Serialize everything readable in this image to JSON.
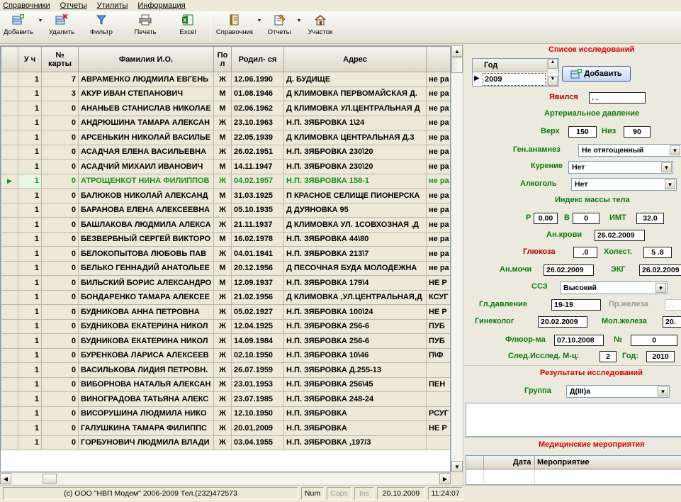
{
  "menu": [
    "Справочники",
    "Отчеты",
    "Утилиты",
    "Информация"
  ],
  "toolbar": [
    {
      "label": "Добавить",
      "icon": "add-record-icon",
      "dropdown": true
    },
    {
      "label": "Удалить",
      "icon": "delete-record-icon"
    },
    {
      "label": "Фильтр",
      "icon": "filter-icon"
    },
    {
      "label": "Печать",
      "icon": "printer-icon"
    },
    {
      "label": "Excel",
      "icon": "excel-icon"
    },
    {
      "label": "Справочник",
      "icon": "reference-book-icon",
      "dropdown": true
    },
    {
      "label": "Отчеты",
      "icon": "reports-icon",
      "dropdown": true
    },
    {
      "label": "Участок",
      "icon": "house-icon"
    }
  ],
  "table": {
    "columns": [
      "У ч",
      "№ карты",
      "Фамилия И.О.",
      "По л",
      "Родил- ся",
      "Адрес",
      ""
    ],
    "selected_row": 7,
    "rows": [
      [
        "1",
        "7",
        "АВРАМЕНКО ЛЮДМИЛА ЕВГЕНЬ",
        "Ж",
        "12.06.1990",
        "Д. БУДИЩЕ",
        "не ра"
      ],
      [
        "1",
        "3",
        "АКУР ИВАН СТЕПАНОВИЧ",
        "М",
        "01.08.1946",
        "Д КЛИМОВКА ПЕРВОМАЙСКАЯ Д.",
        "не ра"
      ],
      [
        "1",
        "0",
        "АНАНЬЕВ СТАНИСЛАВ НИКОЛАЕ",
        "М",
        "02.06.1962",
        "Д КЛИМОВКА УЛ.ЦЕНТРАЛЬНАЯ Д",
        "не ра"
      ],
      [
        "1",
        "0",
        "АНДРЮШИНА ТАМАРА АЛЕКСАН",
        "Ж",
        "23.10.1963",
        "Н.П. ЗЯБРОВКА 1\\24",
        "не ра"
      ],
      [
        "1",
        "0",
        "АРСЕНЬКИН НИКОЛАЙ ВАСИЛЬЕ",
        "М",
        "22.05.1939",
        "Д КЛИМОВКА ЦЕНТРАЛЬНАЯ Д.3",
        "не ра"
      ],
      [
        "1",
        "0",
        "АСАДЧАЯ ЕЛЕНА ВАСИЛЬЕВНА",
        "Ж",
        "26.02.1951",
        "Н.П. ЗЯБРОВКА 230\\20",
        "не ра"
      ],
      [
        "1",
        "0",
        "АСАДЧИЙ МИХАИЛ ИВАНОВИЧ",
        "М",
        "14.11.1947",
        "Н.П. ЗЯБРОВКА 230\\20",
        "не ра"
      ],
      [
        "1",
        "0",
        "АТРОЩЕНКОТ НИНА ФИЛИППОВ",
        "Ж",
        "04.02.1957",
        "Н.П. ЗЯБРОВКА 158-1",
        "не ра"
      ],
      [
        "1",
        "0",
        "БАЛЮКОВ НИКОЛАЙ АЛЕКСАНД",
        "М",
        "31.03.1925",
        "П КРАСНОЕ СЕЛИЩЕ ПИОНЕРСКА",
        "не ра"
      ],
      [
        "1",
        "0",
        "БАРАНОВА ЕЛЕНА АЛЕКСЕЕВНА",
        "Ж",
        "05.10.1935",
        "Д ДУЯНОВКА 95",
        "не ра"
      ],
      [
        "1",
        "0",
        "БАШЛАКОВА ЛЮДМИЛА АЛЕКСА",
        "Ж",
        "21.11.1937",
        "Д КЛИМОВКА УЛ. 1СОВХОЗНАЯ ,Д",
        "не ра"
      ],
      [
        "1",
        "0",
        "БЕЗВЕРБНЫЙ СЕРГЕЙ ВИКТОРО",
        "М",
        "16.02.1978",
        "Н.П. ЗЯБРОВКА 44\\80",
        "не ра"
      ],
      [
        "1",
        "0",
        "БЕЛОКОПЫТОВА ЛЮБОВЬ ПАВ",
        "Ж",
        "04.01.1941",
        "Н.П. ЗЯБРОВКА 213\\7",
        "не ра"
      ],
      [
        "1",
        "0",
        "БЕЛЬКО ГЕННАДИЙ АНАТОЛЬЕЕ",
        "М",
        "20.12.1956",
        "Д ПЕСОЧНАЯ БУДА МОЛОДЕЖНА",
        "не ра"
      ],
      [
        "1",
        "0",
        "БИЛЬСКИЙ БОРИС АЛЕКСАНДРО",
        "М",
        "12.09.1937",
        "Н.П. ЗЯБРОВКА 179\\4",
        "НЕ Р"
      ],
      [
        "1",
        "0",
        "БОНДАРЕНКО ТАМАРА АЛЕКСЕЕ",
        "Ж",
        "21.02.1956",
        "Д КЛИМОВКА ,УЛ.ЦЕНТРАЛЬНАЯ,Д",
        "КСУГ"
      ],
      [
        "1",
        "0",
        "БУДНИКОВА АННА ПЕТРОВНА",
        "Ж",
        "05.02.1927",
        "Н.П. ЗЯБРОВКА 100\\24",
        "НЕ Р"
      ],
      [
        "1",
        "0",
        "БУДНИКОВА ЕКАТЕРИНА НИКОЛ",
        "Ж",
        "12.04.1925",
        "Н.П. ЗЯБРОВКА 256-6",
        "ПУБ"
      ],
      [
        "1",
        "0",
        "БУДНИКОВА ЕКАТЕРИНА НИКОЛ",
        "Ж",
        "14.09.1984",
        "Н.П. ЗЯБРОВКА 256-6",
        "ПУБ"
      ],
      [
        "1",
        "0",
        "БУРЕНКОВА ЛАРИСА АЛЕКСЕЕВ",
        "Ж",
        "02.10.1950",
        "Н.П. ЗЯБРОВКА 10\\46",
        "П\\Ф"
      ],
      [
        "1",
        "0",
        "ВАСИЛЬКОВА ЛИДИЯ ПЕТРОВН.",
        "Ж",
        "26.07.1959",
        "Н.П. ЗЯБРОВКА Д.255-13",
        ""
      ],
      [
        "1",
        "0",
        "ВИБОРНОВА НАТАЛЬЯ АЛЕКСАН",
        "Ж",
        "23.01.1953",
        "Н.П. ЗЯБРОВКА 256\\45",
        "ПЕН"
      ],
      [
        "1",
        "0",
        "ВИНОГРАДОВА ТАТЬЯНА АЛЕКС",
        "Ж",
        "23.07.1985",
        "Н.П. ЗЯБРОВКА 248-24",
        ""
      ],
      [
        "1",
        "0",
        "ВИСОРУШИНА ЛЮДМИЛА НИКО",
        "Ж",
        "12.10.1950",
        "Н.П. ЗЯБРОВКА",
        "РСУГ"
      ],
      [
        "1",
        "0",
        "ГАЛУШКИНА ТАМАРА ФИЛИППС",
        "Ж",
        "20.01.2009",
        "Н.П. ЗЯБРОВКА",
        "НЕ Р"
      ],
      [
        "1",
        "0",
        "ГОРБУНОВИЧ ЛЮДМИЛА ВЛАДИ",
        "Ж",
        "03.04.1955",
        "Н.П. ЗЯБРОВКА ,197/3",
        ""
      ]
    ]
  },
  "status": {
    "copyright": "(с) ООО \"НВП Модем\" 2006-2009  Тел.(232)472573",
    "num": "Num",
    "caps": "Caps",
    "ins": "Ins",
    "date": "20.10.2009",
    "time": "11:24:07"
  },
  "panel": {
    "title_list": "Список исследований",
    "year_header": "Год",
    "year_value": "2009",
    "add_button": "Добавить",
    "appeared_label": "Явился",
    "appeared_value": " .  .",
    "bp_title": "Артериальное давление",
    "upper_label": "Верх",
    "upper_value": "150",
    "lower_label": "Низ",
    "lower_value": "90",
    "anamnesis_label": "Ген.анамнез",
    "anamnesis_value": "Не отягощенный",
    "smoking_label": "Курение",
    "smoking_value": "Нет",
    "alcohol_label": "Алкоголь",
    "alcohol_value": "Нет",
    "bmi_title": "Индекс массы тела",
    "p_label": "Р",
    "p_value": "0.00",
    "v_label": "В",
    "v_value": "0",
    "imt_label": "ИМТ",
    "imt_value": "32.0",
    "blood_label": "Ан.крови",
    "blood_value": "26.02.2009",
    "glucose_label": "Глюкоза",
    "glucose_value": ".0",
    "chol_label": "Холест.",
    "chol_value": "5 .8",
    "urine_label": "Ан.мочи",
    "urine_value": "26.02.2009",
    "ecg_label": "ЭКГ",
    "ecg_value": "26.02.2009",
    "ssz_label": "ССЗ",
    "ssz_value": "Высокий",
    "eye_label": "Гл.давление",
    "eye_value": "19-19",
    "prostate_label": "Пр.железа",
    "prostate_value": " .  .",
    "gyn_label": "Гинеколог",
    "gyn_value": "20.02.2009",
    "breast_label": "Мол.железа",
    "breast_value": "20.",
    "fluoro_label": "Флюор-ма",
    "fluoro_value": "07.10.2008",
    "no_label": "№",
    "no_value": "0",
    "next_label": "След.Исслед. М-ц:",
    "next_month": "2",
    "year_label": "Год:",
    "next_year": "2010",
    "results_title": "Результаты исследований",
    "group_label": "Группа",
    "group_value": "Д(III)а",
    "measures_title": "Медицинские мероприятия",
    "measures_col_date": "Дата",
    "measures_col_event": "Мероприятие"
  },
  "colors": {
    "section_title": "#d40000",
    "label_red": "#b00000",
    "label_green": "#0d7a0d",
    "selected_row_text": "#1a8f1a"
  }
}
